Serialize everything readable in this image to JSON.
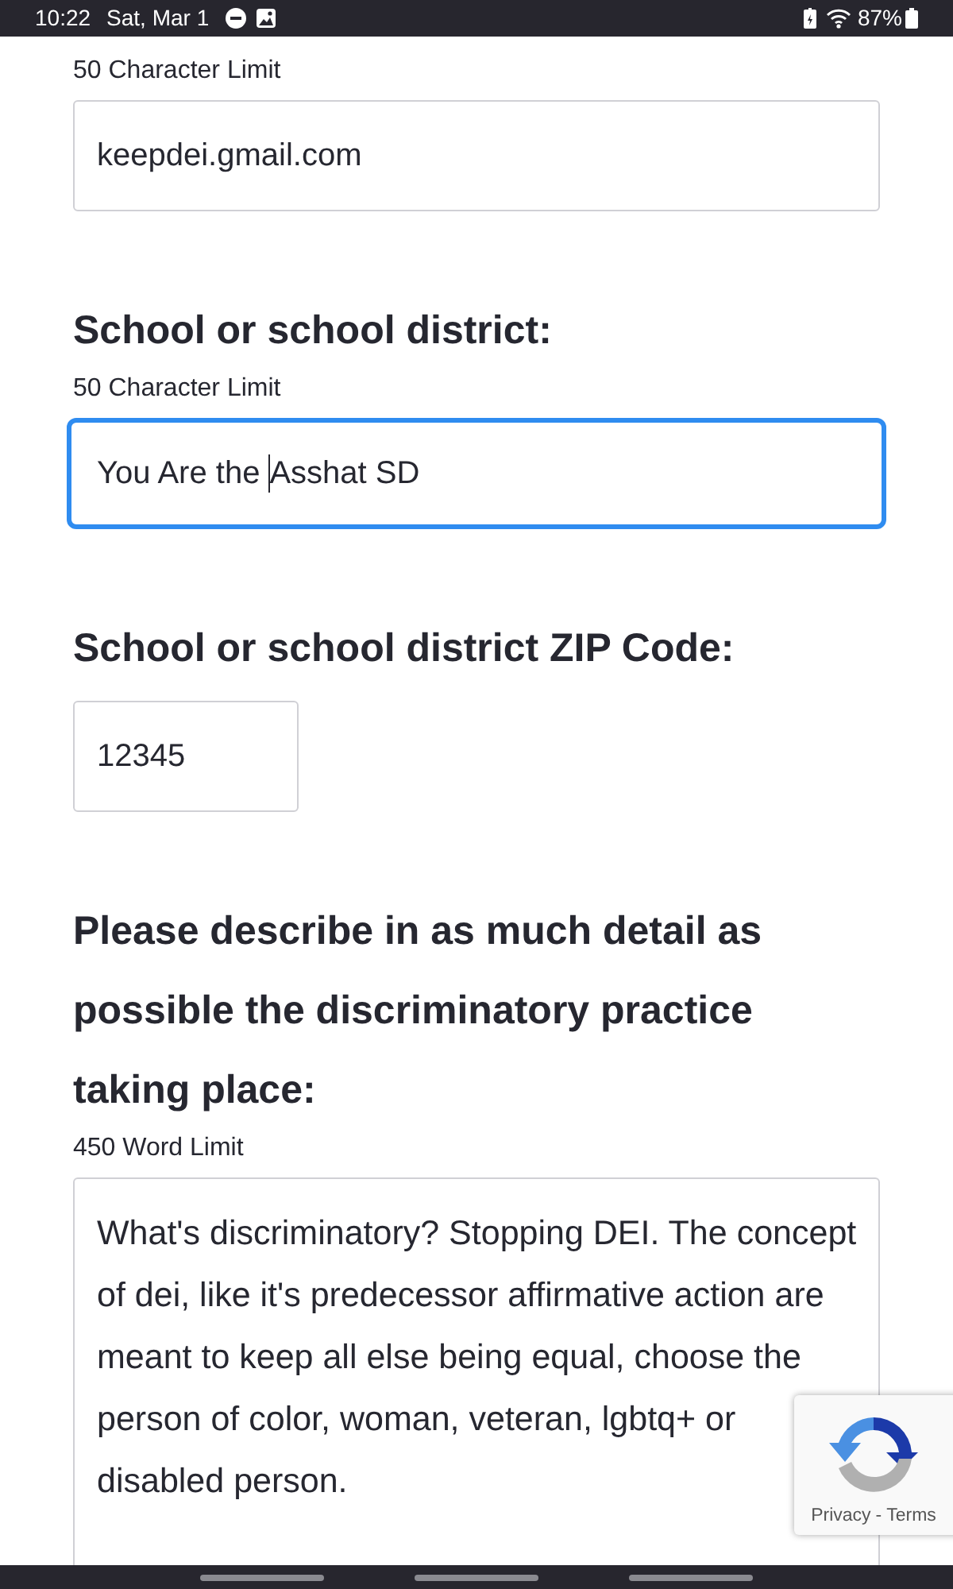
{
  "status_bar": {
    "time": "10:22",
    "date": "Sat, Mar 1",
    "battery": "87%"
  },
  "fields": [
    {
      "kind": "text",
      "hint": "50 Character Limit",
      "value": "keepdei.gmail.com",
      "focused": false
    },
    {
      "kind": "text",
      "label": "School or school district:",
      "hint": "50 Character Limit",
      "text_before_caret": "You Are the",
      "text_after_caret": "Asshat SD",
      "focused": true
    },
    {
      "kind": "zip",
      "label": "School or school district ZIP Code:",
      "value": "12345",
      "focused": false
    },
    {
      "kind": "textarea",
      "label": "Please describe in as much detail as possible the discriminatory practice taking place:",
      "hint": "450 Word Limit",
      "value": "What's discriminatory? Stopping DEI. The concept of dei, like it's predecessor affirmative action are meant to keep all else being equal, choose the person of color, woman, veteran, lgbtq+ or disabled person.",
      "focused": false
    }
  ],
  "recaptcha": {
    "links": [
      "Privacy",
      "Terms"
    ],
    "separator": "-"
  }
}
